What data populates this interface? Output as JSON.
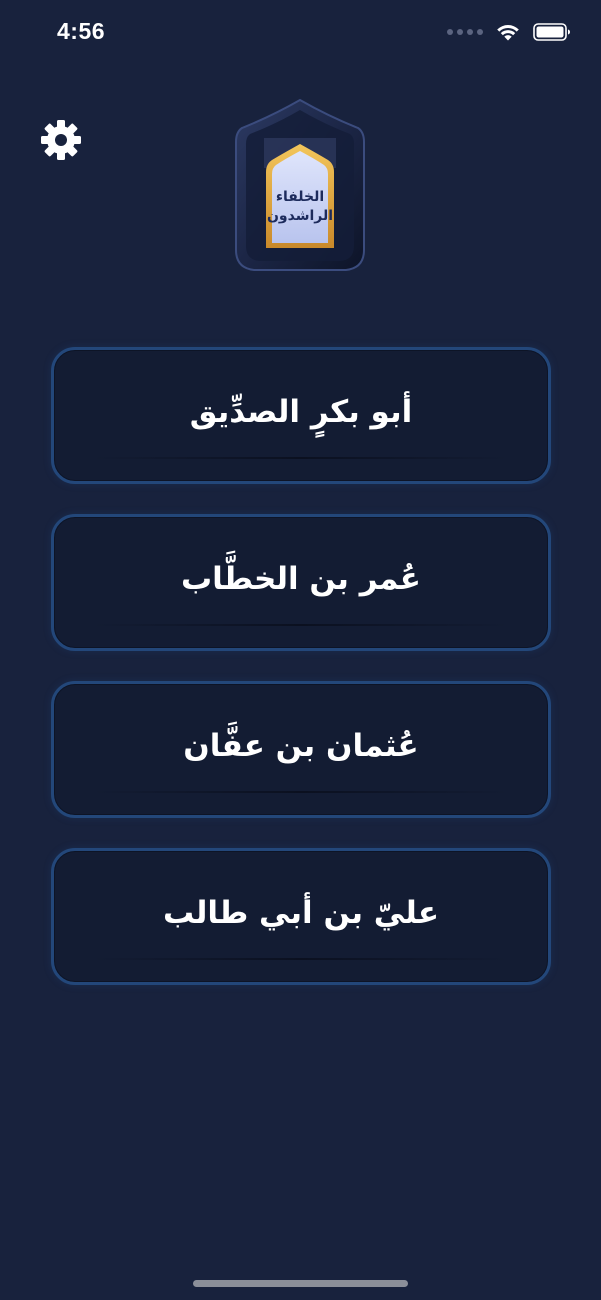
{
  "status_bar": {
    "time": "4:56"
  },
  "header": {
    "settings_icon": "gear-icon",
    "logo_text_line1": "الخلفاء",
    "logo_text_line2": "الراشدون"
  },
  "menu": {
    "items": [
      {
        "label": "أبو بكرٍ الصدِّيق"
      },
      {
        "label": "عُمر بن الخطَّاب"
      },
      {
        "label": "عُثمان بن عفَّان"
      },
      {
        "label": "عليّ بن أبي طالب"
      }
    ]
  },
  "colors": {
    "background": "#18223d",
    "button_fill": "#131c33",
    "button_border": "#23477a",
    "logo_gold": "#d9a53c",
    "logo_panel": "#c9d3f5"
  }
}
